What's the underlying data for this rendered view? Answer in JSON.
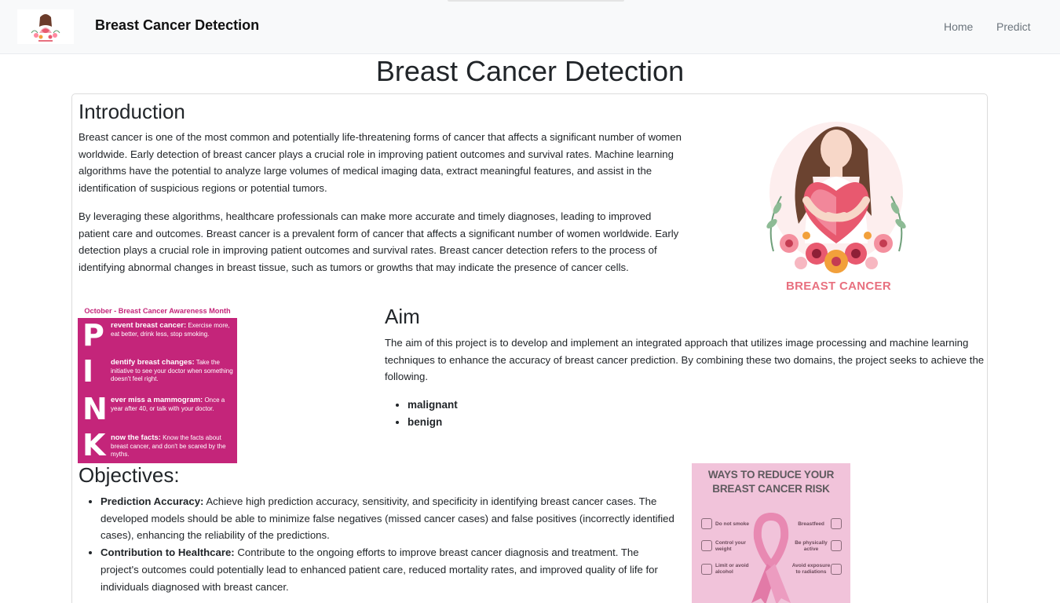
{
  "navbar": {
    "brand": "Breast Cancer Detection",
    "links": [
      {
        "label": "Home"
      },
      {
        "label": "Predict"
      }
    ]
  },
  "page": {
    "title": "Breast Cancer Detection"
  },
  "introduction": {
    "heading": "Introduction",
    "paragraphs": [
      "Breast cancer is one of the most common and potentially life-threatening forms of cancer that affects a significant number of women worldwide. Early detection of breast cancer plays a crucial role in improving patient outcomes and survival rates. Machine learning algorithms have the potential to analyze large volumes of medical imaging data, extract meaningful features, and assist in the identification of suspicious regions or potential tumors.",
      "By leveraging these algorithms, healthcare professionals can make more accurate and timely diagnoses, leading to improved patient care and outcomes. Breast cancer is a prevalent form of cancer that affects a significant number of women worldwide. Early detection plays a crucial role in improving patient outcomes and survival rates. Breast cancer detection refers to the process of identifying abnormal changes in breast tissue, such as tumors or growths that may indicate the presence of cancer cells."
    ],
    "hero_caption": "BREAST CANCER"
  },
  "pink_poster": {
    "header": "October - Breast Cancer Awareness Month",
    "items": [
      {
        "letter": "P",
        "bold": "revent breast cancer:",
        "text": " Exercise more, eat better, drink less, stop smoking."
      },
      {
        "letter": "I",
        "bold": "dentify breast changes:",
        "text": " Take the initiative to see your doctor when something doesn't feel right."
      },
      {
        "letter": "N",
        "bold": "ever miss a mammogram:",
        "text": " Once a year after 40, or talk with your doctor."
      },
      {
        "letter": "K",
        "bold": "now the facts:",
        "text": " Know the facts about breast cancer, and don't be scared by the myths."
      }
    ]
  },
  "aim": {
    "heading": "Aim",
    "paragraph": "The aim of this project is to develop and implement an integrated approach that utilizes image processing and machine learning techniques to enhance the accuracy of breast cancer prediction. By combining these two domains, the project seeks to achieve the following.",
    "items": [
      "malignant",
      "benign"
    ]
  },
  "objectives": {
    "heading": "Objectives:",
    "items": [
      {
        "bold": "Prediction Accuracy:",
        "text": " Achieve high prediction accuracy, sensitivity, and specificity in identifying breast cancer cases. The developed models should be able to minimize false negatives (missed cancer cases) and false positives (incorrectly identified cases), enhancing the reliability of the predictions."
      },
      {
        "bold": "Contribution to Healthcare:",
        "text": " Contribute to the ongoing efforts to improve breast cancer diagnosis and treatment. The project's outcomes could potentially lead to enhanced patient care, reduced mortality rates, and improved quality of life for individuals diagnosed with breast cancer."
      }
    ]
  },
  "ways_poster": {
    "title_line1": "WAYS TO REDUCE YOUR",
    "title_line2": "BREAST CANCER RISK",
    "left_items": [
      "Do not smoke",
      "Control your weight",
      "Limit or avoid alcohol"
    ],
    "right_items": [
      "Breastfeed",
      "Be physically active",
      "Avoid exposure to radiations"
    ]
  },
  "colors": {
    "brand_pink": "#c4257a",
    "caption_pink": "#e8707f",
    "ways_bg": "#f1c3da"
  }
}
